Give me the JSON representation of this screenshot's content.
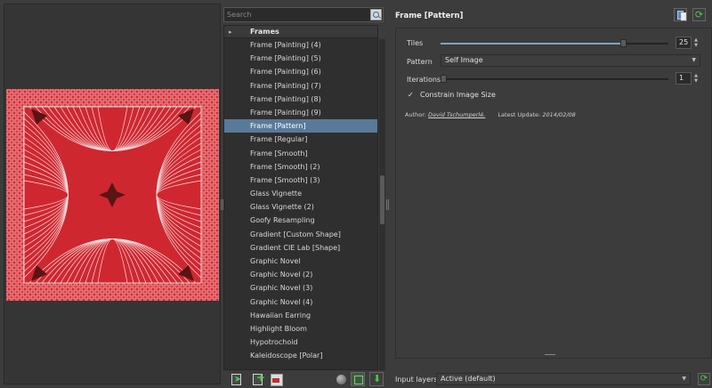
{
  "search": {
    "placeholder": "Search"
  },
  "tree": {
    "category": "Frames",
    "items": [
      "Frame [Painting] (4)",
      "Frame [Painting] (5)",
      "Frame [Painting] (6)",
      "Frame [Painting] (7)",
      "Frame [Painting] (8)",
      "Frame [Painting] (9)",
      "Frame [Pattern]",
      "Frame [Regular]",
      "Frame [Smooth]",
      "Frame [Smooth] (2)",
      "Frame [Smooth] (3)",
      "Glass Vignette",
      "Glass Vignette (2)",
      "Goofy Resampling",
      "Gradient [Custom Shape]",
      "Gradient CIE Lab [Shape]",
      "Graphic Novel",
      "Graphic Novel (2)",
      "Graphic Novel (3)",
      "Graphic Novel (4)",
      "Hawaiian Earring",
      "Highlight Bloom",
      "Hypotrochoid",
      "Kaleidoscope [Polar]"
    ],
    "selected_index": 6
  },
  "filter": {
    "title": "Frame [Pattern]",
    "params": {
      "tiles_label": "Tiles",
      "tiles_value": "25",
      "tiles_fraction": 0.8,
      "pattern_label": "Pattern",
      "pattern_value": "Self Image",
      "iterations_label": "Iterations",
      "iterations_value": "1",
      "iterations_fraction": 0.0,
      "constrain_checked": "✓",
      "constrain_label": "Constrain Image Size"
    },
    "author_label": "Author:",
    "author_name": "David Tschumperlé.",
    "update_label": "Latest Update:",
    "update_date": "2014/02/08"
  },
  "input_layers": {
    "label": "Input layers",
    "value": "Active (default)"
  },
  "colors": {
    "selection": "#5a7a99",
    "slider_fill": "#7fa3c6",
    "preview_red": "#d4282f",
    "accent_green": "#4cc84c"
  }
}
